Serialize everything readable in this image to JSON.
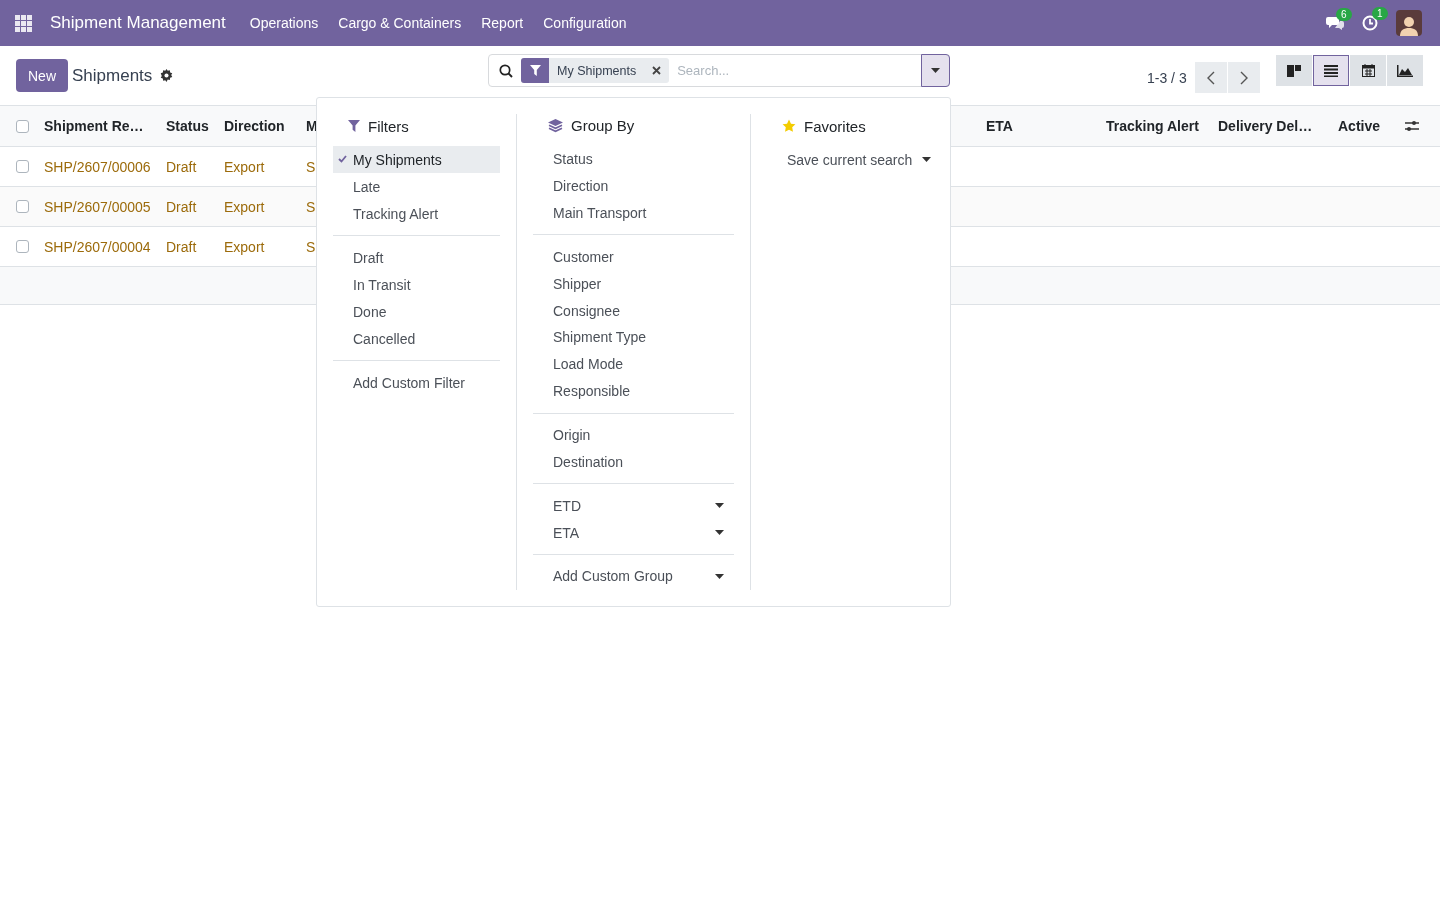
{
  "navbar": {
    "app_name": "Shipment Management",
    "menus": [
      "Operations",
      "Cargo & Containers",
      "Report",
      "Configuration"
    ],
    "messages_count": "6",
    "activities_count": "1"
  },
  "control_panel": {
    "new_button": "New",
    "title": "Shipments",
    "search": {
      "facet": "My Shipments",
      "placeholder": "Search..."
    },
    "pager": "1-3 / 3",
    "views": [
      {
        "kind": "kanban",
        "selected": false
      },
      {
        "kind": "list",
        "selected": true
      },
      {
        "kind": "calendar",
        "selected": false
      },
      {
        "kind": "graph",
        "selected": false
      }
    ]
  },
  "table": {
    "all_checked": false,
    "columns": [
      "Shipment Re…",
      "Status",
      "Direction",
      "M",
      "ETA",
      "Tracking Alert",
      "Delivery Del…",
      "Active"
    ],
    "rows": [
      {
        "checked": false,
        "cells": [
          "SHP/2607/00006",
          "Draft",
          "Export",
          "S"
        ]
      },
      {
        "checked": false,
        "cells": [
          "SHP/2607/00005",
          "Draft",
          "Export",
          "S"
        ]
      },
      {
        "checked": false,
        "cells": [
          "SHP/2607/00004",
          "Draft",
          "Export",
          "S"
        ]
      }
    ]
  },
  "search_panel": {
    "filters": {
      "title": "Filters",
      "groups": [
        [
          {
            "label": "My Shipments",
            "selected": true
          },
          {
            "label": "Late",
            "selected": false
          },
          {
            "label": "Tracking Alert",
            "selected": false
          }
        ],
        [
          {
            "label": "Draft",
            "selected": false
          },
          {
            "label": "In Transit",
            "selected": false
          },
          {
            "label": "Done",
            "selected": false
          },
          {
            "label": "Cancelled",
            "selected": false
          }
        ],
        [
          {
            "label": "Add Custom Filter",
            "selected": false
          }
        ]
      ]
    },
    "group_by": {
      "title": "Group By",
      "groups": [
        [
          {
            "label": "Status",
            "kind": "item"
          },
          {
            "label": "Direction",
            "kind": "item"
          },
          {
            "label": "Main Transport",
            "kind": "item"
          }
        ],
        [
          {
            "label": "Customer",
            "kind": "item"
          },
          {
            "label": "Shipper",
            "kind": "item"
          },
          {
            "label": "Consignee",
            "kind": "item"
          },
          {
            "label": "Shipment Type",
            "kind": "item"
          },
          {
            "label": "Load Mode",
            "kind": "item"
          },
          {
            "label": "Responsible",
            "kind": "item"
          }
        ],
        [
          {
            "label": "Origin",
            "kind": "item"
          },
          {
            "label": "Destination",
            "kind": "item"
          }
        ],
        [
          {
            "label": "ETD",
            "kind": "submenu"
          },
          {
            "label": "ETA",
            "kind": "submenu"
          }
        ],
        [
          {
            "label": "Add Custom Group",
            "kind": "submenu"
          }
        ]
      ]
    },
    "favorites": {
      "title": "Favorites",
      "save_search": "Save current search"
    }
  }
}
